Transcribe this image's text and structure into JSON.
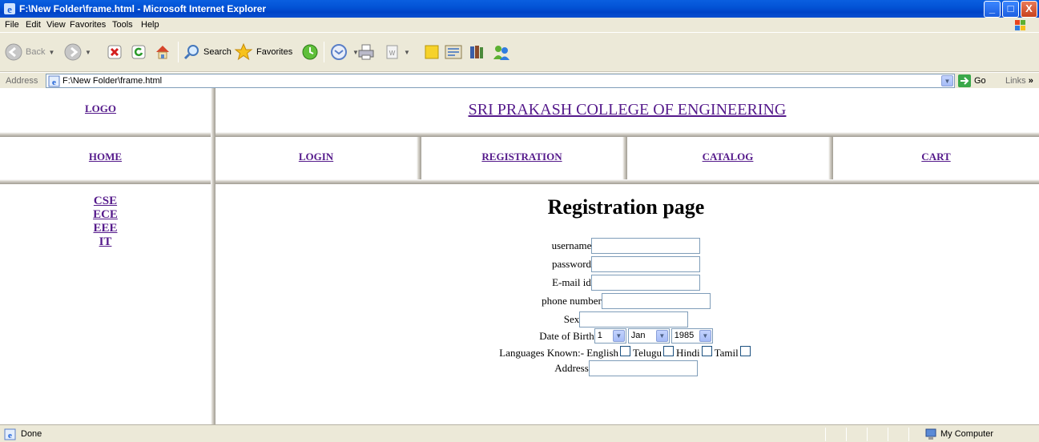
{
  "window": {
    "title": "F:\\New Folder\\frame.html - Microsoft Internet Explorer",
    "minimize": "_",
    "maximize": "□",
    "close": "X"
  },
  "menu": [
    "File",
    "Edit",
    "View",
    "Favorites",
    "Tools",
    "Help"
  ],
  "toolbar": {
    "back": "Back",
    "search": "Search",
    "favorites": "Favorites"
  },
  "address": {
    "label": "Address",
    "url": "F:\\New Folder\\frame.html",
    "go": "Go",
    "links": "Links"
  },
  "page": {
    "logo": "LOGO",
    "college": "SRI PRAKASH COLLEGE OF ENGINEERING",
    "nav": [
      "HOME",
      "LOGIN",
      "REGISTRATION",
      "CATALOG",
      "CART"
    ],
    "departments": [
      "CSE",
      "ECE",
      "EEE",
      "IT"
    ],
    "heading": "Registration page",
    "form": {
      "username": "username",
      "password": "password",
      "email": "E-mail id",
      "phone": "phone number",
      "sex": "Sex",
      "dob": "Date of Birth",
      "dob_day": "1",
      "dob_month": "Jan",
      "dob_year": "1985",
      "languages_label": "Languages Known:- English",
      "lang_telugu": "Telugu",
      "lang_hindi": "Hindi",
      "lang_tamil": "Tamil",
      "address": "Address"
    }
  },
  "status": {
    "text": "Done",
    "zone": "My Computer"
  }
}
